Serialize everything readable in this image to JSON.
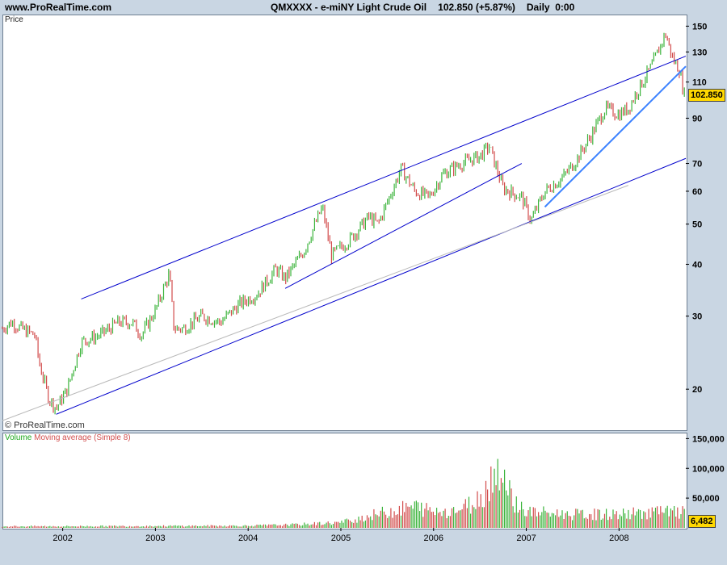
{
  "header": {
    "site": "www.ProRealTime.com",
    "symbol": "QMXXXX - e-miNY Light Crude Oil",
    "last": "102.850 (+5.87%)",
    "period": "Daily  0:00"
  },
  "price_panel": {
    "label": "Price",
    "copyright": "© ProRealTime.com",
    "last_badge": "102.850"
  },
  "volume_panel": {
    "label_part1": "Volume",
    "label_part2": "Moving average (Simple 8)",
    "last_badge": "6,482"
  },
  "colors": {
    "up": "#3cb43c",
    "down": "#d24b4b",
    "trendline": "#0000cc",
    "trendline_light": "#3c82ff",
    "badge": "#ffd800"
  },
  "chart_data": [
    {
      "type": "line",
      "name": "price",
      "scale": "log",
      "ylim": [
        16,
        160
      ],
      "xlim": [
        2001.35,
        2008.72
      ],
      "yticks": [
        20,
        30,
        40,
        50,
        60,
        70,
        90,
        110,
        130,
        150
      ],
      "x_ticks": [
        "2002",
        "2003",
        "2004",
        "2005",
        "2006",
        "2007",
        "2008"
      ],
      "series": [
        {
          "values": [
            [
              2001.35,
              28
            ],
            [
              2001.45,
              29
            ],
            [
              2001.55,
              28
            ],
            [
              2001.7,
              27
            ],
            [
              2001.75,
              23
            ],
            [
              2001.85,
              19
            ],
            [
              2001.93,
              18
            ],
            [
              2002.05,
              20
            ],
            [
              2002.2,
              26
            ],
            [
              2002.4,
              27
            ],
            [
              2002.6,
              29
            ],
            [
              2002.75,
              29
            ],
            [
              2002.85,
              27
            ],
            [
              2003.0,
              31
            ],
            [
              2003.15,
              38
            ],
            [
              2003.2,
              28
            ],
            [
              2003.3,
              28
            ],
            [
              2003.5,
              30
            ],
            [
              2003.7,
              29
            ],
            [
              2003.9,
              32
            ],
            [
              2004.1,
              34
            ],
            [
              2004.3,
              39
            ],
            [
              2004.4,
              37
            ],
            [
              2004.6,
              43
            ],
            [
              2004.8,
              55
            ],
            [
              2004.9,
              42
            ],
            [
              2005.1,
              46
            ],
            [
              2005.3,
              52
            ],
            [
              2005.4,
              50
            ],
            [
              2005.55,
              60
            ],
            [
              2005.65,
              68
            ],
            [
              2005.8,
              60
            ],
            [
              2005.95,
              58
            ],
            [
              2006.1,
              66
            ],
            [
              2006.3,
              70
            ],
            [
              2006.5,
              73
            ],
            [
              2006.6,
              77
            ],
            [
              2006.75,
              61
            ],
            [
              2006.95,
              58
            ],
            [
              2007.05,
              51
            ],
            [
              2007.2,
              60
            ],
            [
              2007.4,
              65
            ],
            [
              2007.55,
              72
            ],
            [
              2007.7,
              82
            ],
            [
              2007.85,
              95
            ],
            [
              2008.0,
              92
            ],
            [
              2008.1,
              95
            ],
            [
              2008.2,
              105
            ],
            [
              2008.35,
              120
            ],
            [
              2008.45,
              135
            ],
            [
              2008.5,
              144
            ],
            [
              2008.58,
              125
            ],
            [
              2008.65,
              118
            ],
            [
              2008.7,
              102.85
            ]
          ]
        }
      ]
    },
    {
      "type": "bar",
      "name": "volume",
      "ylim": [
        0,
        160000
      ],
      "yticks": [
        50000,
        100000,
        150000
      ],
      "series": [
        {
          "values": [
            [
              2001.35,
              3000
            ],
            [
              2002.0,
              3000
            ],
            [
              2003.0,
              3500
            ],
            [
              2004.0,
              4000
            ],
            [
              2004.5,
              6000
            ],
            [
              2005.0,
              10000
            ],
            [
              2005.5,
              30000
            ],
            [
              2005.8,
              40000
            ],
            [
              2006.0,
              30000
            ],
            [
              2006.3,
              35000
            ],
            [
              2006.5,
              55000
            ],
            [
              2006.65,
              100000
            ],
            [
              2006.72,
              120000
            ],
            [
              2006.8,
              70000
            ],
            [
              2006.9,
              45000
            ],
            [
              2007.0,
              30000
            ],
            [
              2007.5,
              25000
            ],
            [
              2008.0,
              25000
            ],
            [
              2008.4,
              30000
            ],
            [
              2008.7,
              28000
            ]
          ]
        }
      ]
    }
  ]
}
